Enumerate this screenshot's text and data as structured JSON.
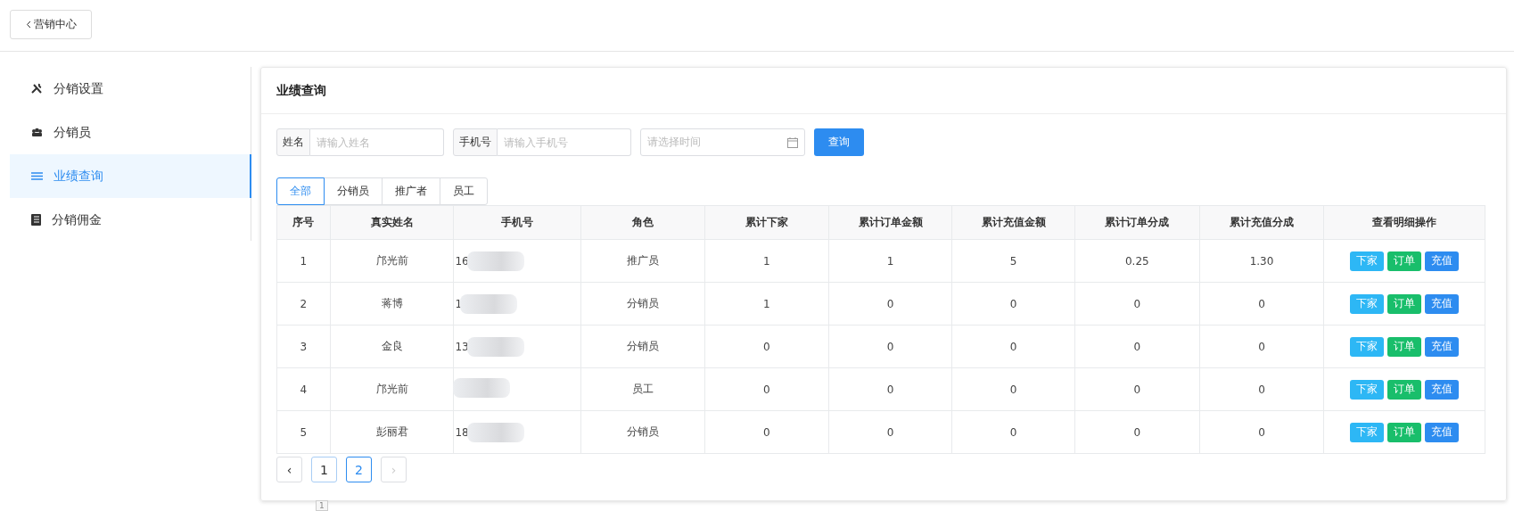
{
  "back_button": {
    "label": "营销中心"
  },
  "sidebar": {
    "items": [
      {
        "label": "分销设置",
        "selected": false
      },
      {
        "label": "分销员",
        "selected": false
      },
      {
        "label": "业绩查询",
        "selected": true
      },
      {
        "label": "分销佣金",
        "selected": false
      }
    ]
  },
  "card": {
    "title": "业绩查询"
  },
  "filters": {
    "name": {
      "label": "姓名",
      "placeholder": "请输入姓名"
    },
    "phone": {
      "label": "手机号",
      "placeholder": "请输入手机号"
    },
    "date": {
      "placeholder": "请选择时间"
    },
    "search_button": "查询"
  },
  "tabs": [
    {
      "label": "全部",
      "selected": true
    },
    {
      "label": "分销员",
      "selected": false
    },
    {
      "label": "推广者",
      "selected": false
    },
    {
      "label": "员工",
      "selected": false
    }
  ],
  "table": {
    "columns": [
      "序号",
      "真实姓名",
      "手机号",
      "角色",
      "累计下家",
      "累计订单金额",
      "累计充值金额",
      "累计订单分成",
      "累计充值分成",
      "查看明细操作"
    ],
    "rows": [
      {
        "no": "1",
        "name": "邝光前",
        "phone": "16",
        "role": "推广员",
        "downline": "1",
        "order_amount": "1",
        "recharge_amount": "5",
        "order_share": "0.25",
        "recharge_share": "1.30",
        "actions": [
          "下家",
          "订单",
          "充值"
        ]
      },
      {
        "no": "2",
        "name": "蒋博",
        "phone": "1",
        "role": "分销员",
        "downline": "1",
        "order_amount": "0",
        "recharge_amount": "0",
        "order_share": "0",
        "recharge_share": "0",
        "actions": [
          "下家",
          "订单",
          "充值"
        ]
      },
      {
        "no": "3",
        "name": "金良",
        "phone": "13",
        "role": "分销员",
        "downline": "0",
        "order_amount": "0",
        "recharge_amount": "0",
        "order_share": "0",
        "recharge_share": "0",
        "actions": [
          "下家",
          "订单",
          "充值"
        ]
      },
      {
        "no": "4",
        "name": "邝光前",
        "role": "员工",
        "downline": "0",
        "order_amount": "0",
        "recharge_amount": "0",
        "order_share": "0",
        "recharge_share": "0",
        "actions": [
          "下家",
          "订单",
          "充值"
        ]
      },
      {
        "no": "5",
        "name": "彭丽君",
        "phone": "18",
        "role": "分销员",
        "downline": "0",
        "order_amount": "0",
        "recharge_amount": "0",
        "order_share": "0",
        "recharge_share": "0",
        "actions": [
          "下家",
          "订单",
          "充值"
        ]
      }
    ]
  },
  "pagination": {
    "prev": "‹",
    "pages": [
      {
        "label": "1",
        "selected": false
      },
      {
        "label": "2",
        "selected": true
      }
    ],
    "next": "›",
    "tooltip": "1"
  }
}
